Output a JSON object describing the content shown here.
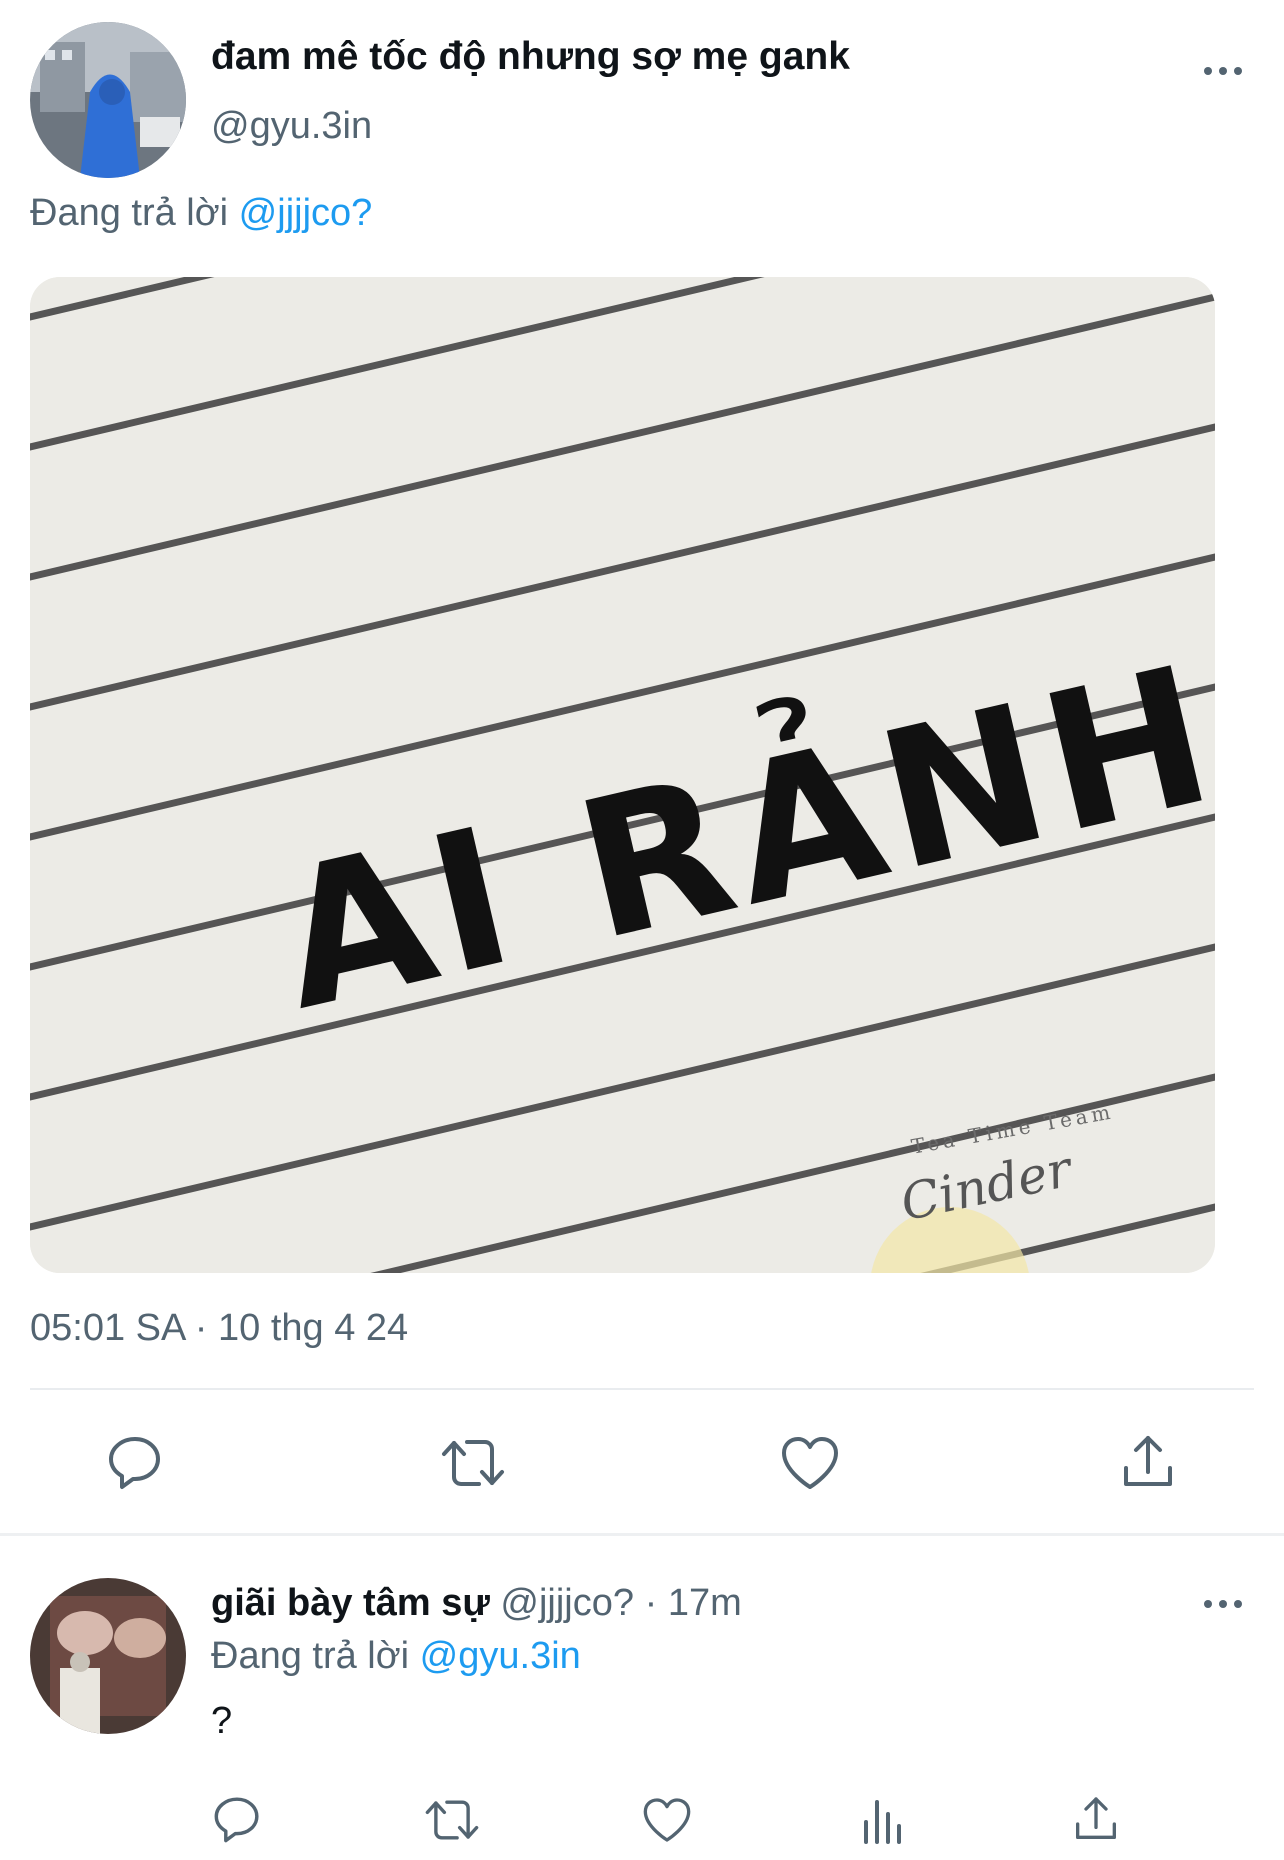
{
  "main_tweet": {
    "display_name": "đam mê tốc độ nhưng sợ mẹ gank",
    "handle": "@gyu.3in",
    "replying_prefix": "Đang trả lời",
    "replying_to": "@jjjjco?",
    "media": {
      "headline": "AI RẢNH.",
      "watermark_top": "Tea Time Team",
      "watermark_script": "Cinder"
    },
    "timestamp": "05:01 SA · 10 thg 4 24",
    "actions": [
      "reply-icon",
      "retweet-icon",
      "like-icon",
      "share-icon"
    ]
  },
  "reply_tweet": {
    "display_name": "giãi bày tâm sự",
    "handle": "@jjjjco?",
    "separator": "·",
    "time": "17m",
    "replying_prefix": "Đang trả lời",
    "replying_to": "@gyu.3in",
    "text": "?",
    "actions": [
      "reply-icon",
      "retweet-icon",
      "like-icon",
      "analytics-icon",
      "share-icon"
    ]
  },
  "colors": {
    "link": "#1d9bf0",
    "secondary_text": "#536471",
    "primary_text": "#0f1419"
  }
}
